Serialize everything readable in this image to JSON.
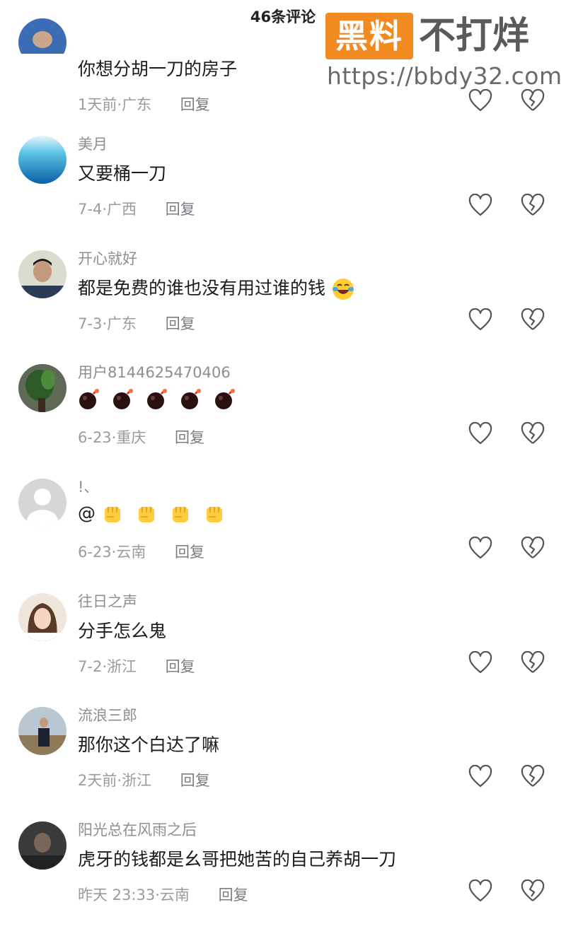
{
  "header": {
    "title": "46条评论"
  },
  "watermark": {
    "badge": "黑料",
    "name": "不打烊",
    "url": "https://bbdy32.com"
  },
  "colors": {
    "meta_gray": "#9a9aa0",
    "watermark_orange": "#f18a21"
  },
  "icons": {
    "like": "heart-outline-icon",
    "dislike": "broken-heart-outline-icon"
  },
  "comments": [
    {
      "username": "",
      "text": "你想分胡一刀的房子",
      "time": "1天前",
      "location": "广东",
      "reply": "回复",
      "avatar": "avatar-blue-partial"
    },
    {
      "username": "美月",
      "text": "又要桶一刀",
      "time": "7-4",
      "location": "广西",
      "reply": "回复",
      "avatar": "avatar-sea"
    },
    {
      "username": "开心就好",
      "text": "都是免费的谁也没有用过谁的钱",
      "time": "7-3",
      "location": "广东",
      "reply": "回复",
      "avatar": "avatar-man-suit",
      "emoji": "laugh-cry"
    },
    {
      "username": "用户8144625470406",
      "text": "",
      "time": "6-23",
      "location": "重庆",
      "reply": "回复",
      "avatar": "avatar-plant",
      "emoji": "bomb",
      "emoji_count": 5
    },
    {
      "username": "!、",
      "text": "@",
      "time": "6-23",
      "location": "云南",
      "reply": "回复",
      "avatar": "avatar-default",
      "emoji": "fist",
      "emoji_count": 4
    },
    {
      "username": "往日之声",
      "text": "分手怎么鬼",
      "time": "7-2",
      "location": "浙江",
      "reply": "回复",
      "avatar": "avatar-girl"
    },
    {
      "username": "流浪三郎",
      "text": "那你这个白达了嘛",
      "time": "2天前",
      "location": "浙江",
      "reply": "回复",
      "avatar": "avatar-man-outdoor"
    },
    {
      "username": "阳光总在风雨之后",
      "text": "虎牙的钱都是幺哥把她苦的自己养胡一刀",
      "time": "昨天 23:33",
      "location": "云南",
      "reply": "回复",
      "avatar": "avatar-dark"
    }
  ]
}
